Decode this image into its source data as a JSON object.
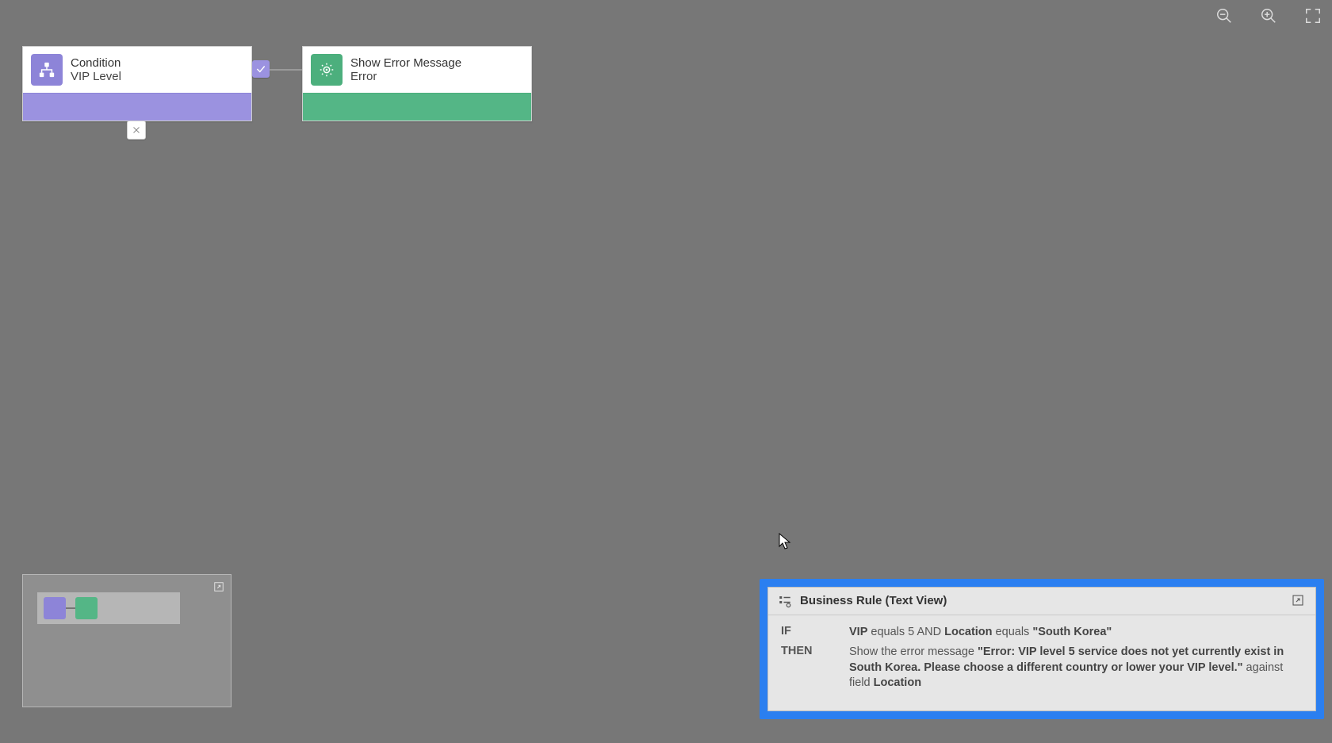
{
  "toolbar": {
    "zoom_out": "Zoom out",
    "zoom_in": "Zoom in",
    "fullscreen": "Full screen"
  },
  "nodes": {
    "condition": {
      "title": "Condition",
      "subtitle": "VIP Level",
      "icon": "branch-icon",
      "accent": "#8d84d8",
      "strip": "#9b92e0"
    },
    "action": {
      "title": "Show Error Message",
      "subtitle": "Error",
      "icon": "gear-eye-icon",
      "accent": "#4caf7d",
      "strip": "#54b686"
    }
  },
  "connector": {
    "true_branch_icon": "check-icon",
    "false_branch_icon": "x-icon"
  },
  "minimap": {
    "label": "Minimap",
    "expand_icon": "expand-icon"
  },
  "textview": {
    "title": "Business Rule (Text View)",
    "expand_icon": "expand-icon",
    "if_kw": "IF",
    "then_kw": "THEN",
    "if_expr": {
      "field1": "VIP",
      "op1": " equals 5 AND ",
      "field2": "Location",
      "op2": " equals ",
      "value2": "\"South Korea\""
    },
    "then_expr": {
      "lead": "Show the error message ",
      "msg": "\"Error: VIP level 5 service does not yet currently exist in South Korea. Please choose a different country or lower your VIP level.\"",
      "tail": " against field ",
      "field": "Location"
    }
  },
  "highlight_color": "#2b7ff0"
}
